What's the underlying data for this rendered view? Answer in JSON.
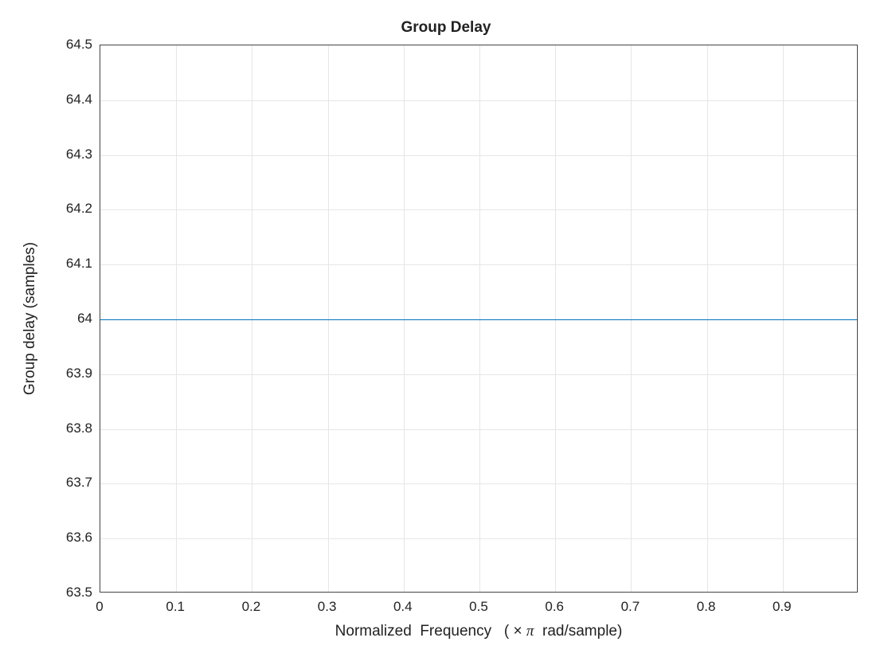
{
  "chart_data": {
    "type": "line",
    "title": "Group Delay",
    "xlabel": "Normalized  Frequency   ( × π  rad/sample)",
    "ylabel": "Group delay (samples)",
    "x": [
      0,
      1
    ],
    "values": [
      64,
      64
    ],
    "xlim": [
      0,
      1
    ],
    "ylim": [
      63.5,
      64.5
    ],
    "x_ticks": [
      0,
      0.1,
      0.2,
      0.3,
      0.4,
      0.5,
      0.6,
      0.7,
      0.8,
      0.9
    ],
    "x_tick_labels": [
      "0",
      "0.1",
      "0.2",
      "0.3",
      "0.4",
      "0.5",
      "0.6",
      "0.7",
      "0.8",
      "0.9"
    ],
    "y_ticks": [
      63.5,
      63.6,
      63.7,
      63.8,
      63.9,
      64,
      64.1,
      64.2,
      64.3,
      64.4,
      64.5
    ],
    "y_tick_labels": [
      "63.5",
      "63.6",
      "63.7",
      "63.8",
      "63.9",
      "64",
      "64.1",
      "64.2",
      "64.3",
      "64.4",
      "64.5"
    ],
    "grid": true,
    "line_color": "#0072BD"
  }
}
